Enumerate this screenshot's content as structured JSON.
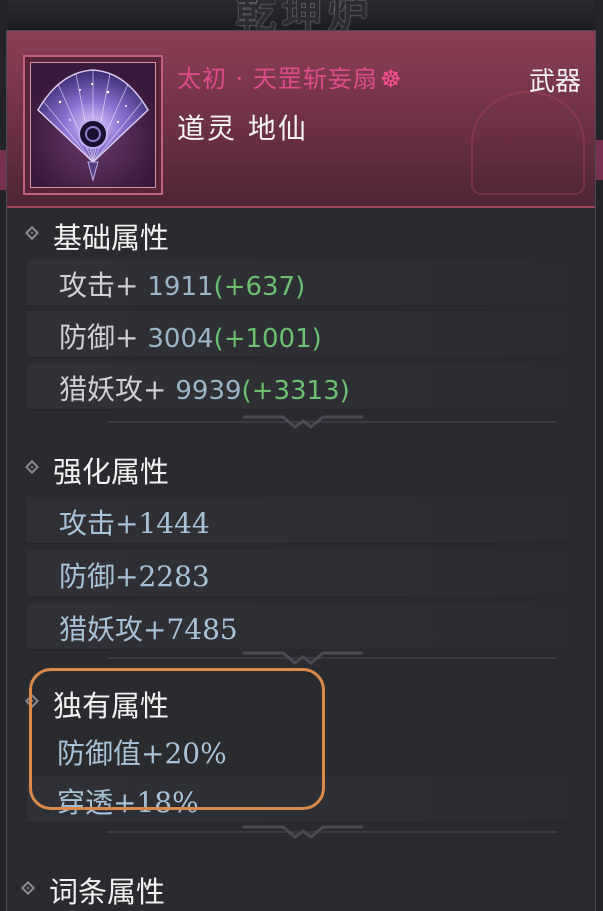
{
  "background": {
    "title": "乾坤炉"
  },
  "item": {
    "name": "太初 · 天罡斩妄扇",
    "seal_icon": "wheel-seal-icon",
    "type": "武器",
    "grade": "道灵 地仙",
    "icon": "galaxy-fan-icon"
  },
  "sections": {
    "base": {
      "title": "基础属性",
      "rows": [
        {
          "label": "攻击+",
          "value": "1911",
          "bonus": "(+637)"
        },
        {
          "label": "防御+",
          "value": "3004",
          "bonus": "(+1001)"
        },
        {
          "label": "猎妖攻+",
          "value": "9939",
          "bonus": "(+3313)"
        }
      ]
    },
    "enhance": {
      "title": "强化属性",
      "rows": [
        {
          "label": "攻击",
          "value": "+1444"
        },
        {
          "label": "防御",
          "value": "+2283"
        },
        {
          "label": "猎妖攻",
          "value": "+7485"
        }
      ]
    },
    "unique": {
      "title": "独有属性",
      "rows": [
        {
          "label": "防御值",
          "value": "+20%"
        },
        {
          "label": "穿透",
          "value": "+18%"
        }
      ]
    },
    "affix": {
      "title": "词条属性"
    }
  },
  "colors": {
    "name": "#e04c8a",
    "bonus": "#6cc070",
    "value": "#9ab4c8",
    "highlight": "#d98a4a",
    "header": "#8c3f55"
  }
}
